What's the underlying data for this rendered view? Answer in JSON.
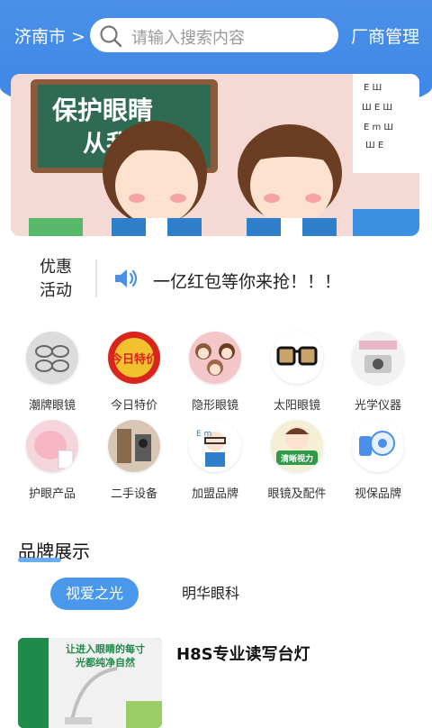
{
  "header": {
    "city": "济南市 >",
    "search_placeholder": "请输入搜索内容",
    "manage_label": "厂商管理",
    "accent": "#4a90e8"
  },
  "banner": {
    "text_line1": "保护眼睛",
    "text_line2": "从我做起!"
  },
  "promo": {
    "label": "优惠活动",
    "icon": "speaker-icon",
    "text": "一亿红包等你来抢！！！"
  },
  "categories": [
    {
      "label": "潮牌眼镜",
      "icon": "trendy-glasses-icon"
    },
    {
      "label": "今日特价",
      "icon": "daily-deal-icon",
      "badge_text": "今日特价"
    },
    {
      "label": "隐形眼镜",
      "icon": "contact-lens-icon"
    },
    {
      "label": "太阳眼镜",
      "icon": "sunglasses-icon"
    },
    {
      "label": "光学仪器",
      "icon": "optical-instrument-icon"
    },
    {
      "label": "护眼产品",
      "icon": "eye-care-icon"
    },
    {
      "label": "二手设备",
      "icon": "used-equipment-icon"
    },
    {
      "label": "加盟品牌",
      "icon": "franchise-icon"
    },
    {
      "label": "眼镜及配件",
      "icon": "accessories-icon",
      "badge_text": "清晰视力"
    },
    {
      "label": "视保品牌",
      "icon": "vision-brand-icon"
    }
  ],
  "brand_section": {
    "title": "品牌展示",
    "tabs": [
      {
        "label": "视爱之光",
        "active": true
      },
      {
        "label": "明华眼科",
        "active": false
      }
    ]
  },
  "product": {
    "title": "H8S专业读写台灯",
    "image_caption_line1": "让进入眼睛的每寸",
    "image_caption_line2": "光都纯净自然"
  }
}
